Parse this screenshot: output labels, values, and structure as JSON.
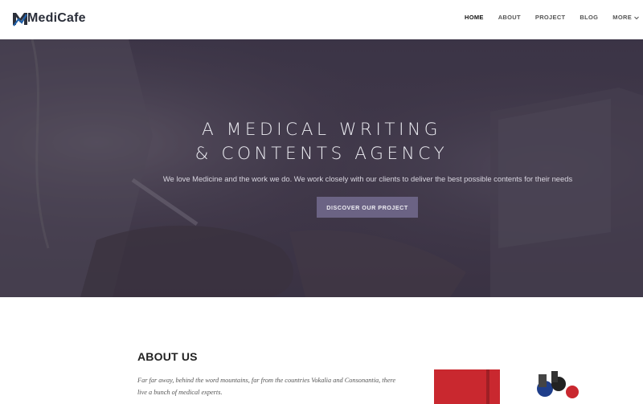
{
  "brand": {
    "name": "MediCafe",
    "mark_color": "#1f5fa8"
  },
  "nav": {
    "items": [
      {
        "label": "HOME",
        "active": true
      },
      {
        "label": "ABOUT",
        "active": false
      },
      {
        "label": "PROJECT",
        "active": false
      },
      {
        "label": "BLOG",
        "active": false
      },
      {
        "label": "MORE",
        "active": false,
        "icon": "chevron-down-icon"
      }
    ]
  },
  "hero": {
    "title_line1": "A MEDICAL WRITING",
    "title_line2": "& CONTENTS AGENCY",
    "subtitle": "We love Medicine and the work we do. We work closely with our clients to deliver the best possible contents for their needs",
    "button_label": "DISCOVER OUR PROJECT",
    "button_color": "#6b6384"
  },
  "about": {
    "title": "ABOUT US",
    "text": "Far far away, behind the word mountains, far from the countries Vokalia and Consonantia, there live a bunch of medical experts."
  }
}
